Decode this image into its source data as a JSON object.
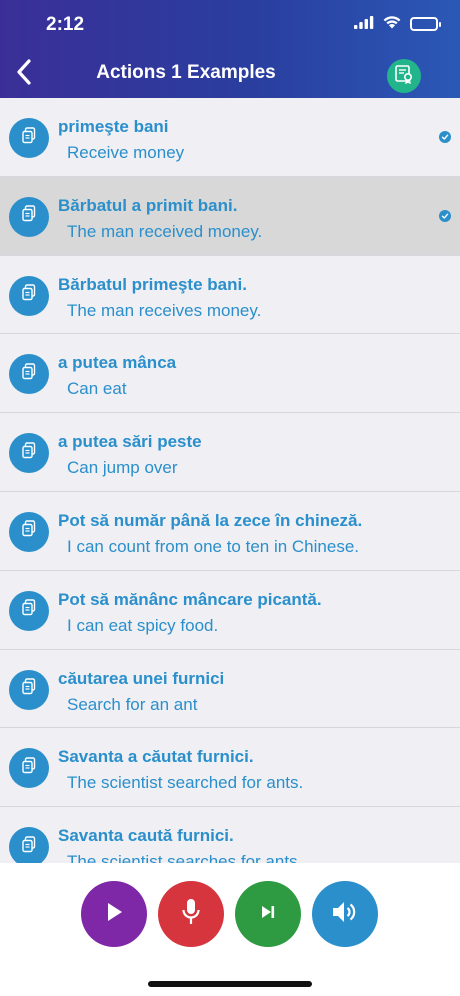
{
  "status_bar": {
    "time": "2:12"
  },
  "nav": {
    "title": "Actions 1 Examples"
  },
  "icons": {
    "back": "chevron-left-icon",
    "badge": "certificate-icon",
    "row": "copy-icon",
    "check": "checkmark-icon",
    "play": "play-icon",
    "mic": "microphone-icon",
    "next": "skip-next-icon",
    "speaker": "speaker-icon"
  },
  "colors": {
    "header_start": "#3a2f98",
    "header_end": "#2b58b6",
    "accent": "#2a8fcb",
    "badge": "#22b58c",
    "play": "#7e27a7",
    "mic": "#d6353d",
    "next": "#2e9b43",
    "speaker": "#2a8fcb"
  },
  "rows": [
    {
      "ro": "primeşte bani",
      "en": "Receive money",
      "checked": true,
      "selected": false
    },
    {
      "ro": "Bărbatul a primit bani.",
      "en": "The man received money.",
      "checked": true,
      "selected": true
    },
    {
      "ro": "Bărbatul primeşte bani.",
      "en": "The man receives money.",
      "checked": false,
      "selected": false
    },
    {
      "ro": "a putea mânca",
      "en": "Can eat",
      "checked": false,
      "selected": false
    },
    {
      "ro": "a putea sări peste",
      "en": "Can jump over",
      "checked": false,
      "selected": false
    },
    {
      "ro": "Pot să număr până la zece în chineză.",
      "en": "I can count from one to ten in Chinese.",
      "checked": false,
      "selected": false
    },
    {
      "ro": "Pot să mănânc mâncare picantă.",
      "en": "I can eat spicy food.",
      "checked": false,
      "selected": false
    },
    {
      "ro": "căutarea unei furnici",
      "en": "Search for an ant",
      "checked": false,
      "selected": false
    },
    {
      "ro": "Savanta a căutat furnici.",
      "en": "The scientist searched for ants.",
      "checked": false,
      "selected": false
    },
    {
      "ro": "Savanta caută furnici.",
      "en": "The scientist searches for ants.",
      "checked": false,
      "selected": false
    }
  ]
}
